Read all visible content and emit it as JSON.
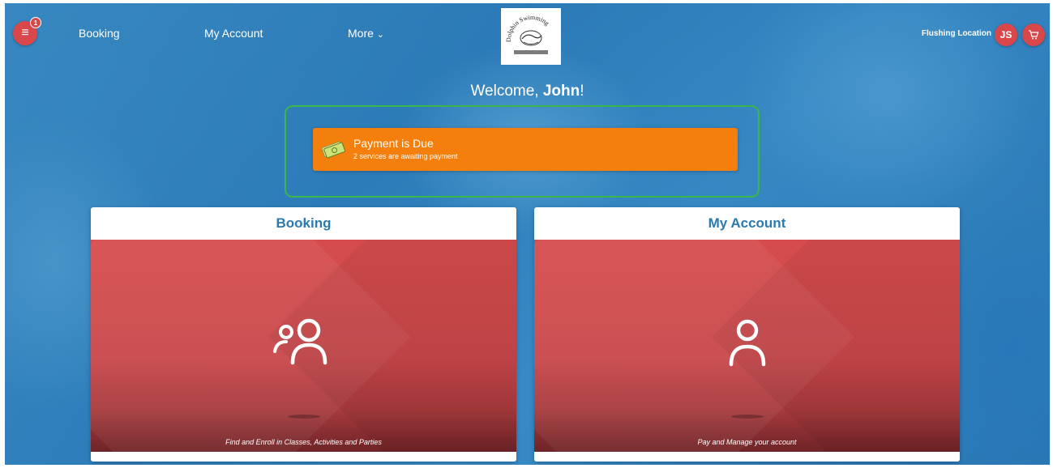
{
  "header": {
    "menu_badge": "1",
    "nav": {
      "booking": "Booking",
      "my_account": "My Account",
      "more": "More"
    },
    "logo_text": "Dolphin Swimming",
    "location": "Flushing Location",
    "avatar_initials": "JS"
  },
  "welcome": {
    "prefix": "Welcome, ",
    "name": "John",
    "suffix": "!"
  },
  "alert": {
    "title": "Payment is Due",
    "subtitle": "2 services are awaiting payment"
  },
  "cards": {
    "booking": {
      "title": "Booking",
      "caption": "Find and Enroll in Classes, Activities and Parties"
    },
    "account": {
      "title": "My Account",
      "caption": "Pay and Manage your account"
    }
  },
  "colors": {
    "accent_red": "#d9474b",
    "alert_orange": "#f47f0c",
    "alert_border": "#3cb54a",
    "title_blue": "#2a7ab0"
  },
  "icons": [
    "menu-icon",
    "chevron-down-icon",
    "cart-icon",
    "money-icon",
    "users-icon",
    "user-icon"
  ]
}
